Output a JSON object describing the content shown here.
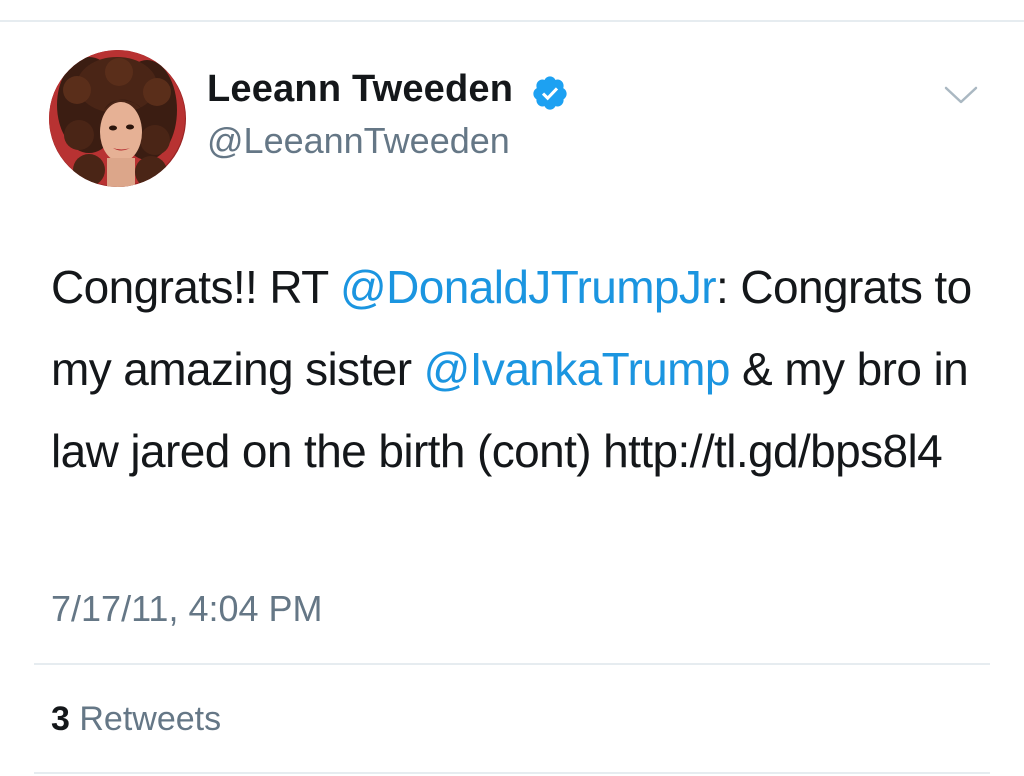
{
  "tweet": {
    "author": {
      "display_name": "Leeann Tweeden",
      "handle": "@LeeannTweeden",
      "verified": true,
      "avatar_icon": "profile-photo"
    },
    "menu_icon": "chevron-down-icon",
    "text": {
      "prefix": "Congrats!! RT ",
      "mention_1": "@DonaldJTrumpJr",
      "after_mention_1": ": Congrats to my amazing sister ",
      "mention_2": "@IvankaTrump",
      "after_mention_2": " & my bro in law jared on the birth (cont) http://tl.gd/bps8l4"
    },
    "timestamp": "7/17/11, 4:04 PM",
    "stats": {
      "retweet_count": "3",
      "retweet_label": "Retweets"
    }
  },
  "colors": {
    "text_primary": "#14171a",
    "text_secondary": "#657786",
    "link": "#1b95e0",
    "verified_badge": "#1da1f2",
    "divider": "#e6ecf0"
  }
}
